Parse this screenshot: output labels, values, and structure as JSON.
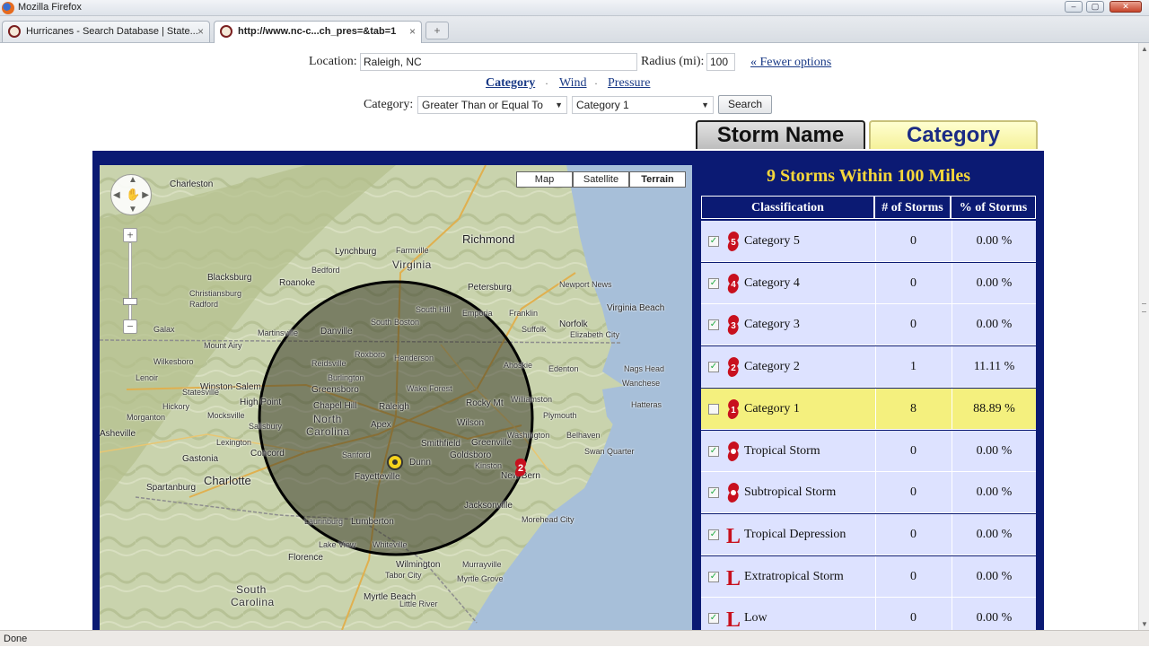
{
  "window": {
    "title": "Mozilla Firefox"
  },
  "tabs": [
    {
      "label": "Hurricanes - Search Database | State..."
    },
    {
      "label": "http://www.nc-c...ch_pres=&tab=1"
    }
  ],
  "form": {
    "location_label": "Location:",
    "location_value": "Raleigh, NC",
    "radius_label": "Radius (mi):",
    "radius_value": "100",
    "fewer_options": "« Fewer options",
    "search_modes": [
      "Category",
      "Wind",
      "Pressure"
    ],
    "category_label": "Category:",
    "comparator": "Greater Than or Equal To",
    "category_value": "Category 1",
    "search_button": "Search"
  },
  "view_tabs": {
    "storm_name": "Storm Name",
    "category": "Category"
  },
  "map": {
    "types": [
      "Map",
      "Satellite",
      "Terrain"
    ],
    "selected_type": "Terrain",
    "center_label": "Raleigh",
    "storm_marker": "2",
    "labels": {
      "charleston_wv": "Charleston",
      "richmond": "Richmond",
      "lynchburg": "Lynchburg",
      "virginia": "Virginia",
      "roanoke": "Roanoke",
      "blacksburg": "Blacksburg",
      "petersburg": "Petersburg",
      "virginia_beach": "Virginia Beach",
      "norfolk": "Norfolk",
      "danville": "Danville",
      "winston_salem": "Winston-Salem",
      "greensboro": "Greensboro",
      "high_point": "High Point",
      "chapel_hill": "Chapel Hill",
      "north_carolina_1": "North",
      "north_carolina_2": "Carolina",
      "apex": "Apex",
      "rocky_mount": "Rocky Mt",
      "wilson": "Wilson",
      "greenville": "Greenville",
      "asheville": "Asheville",
      "concord": "Concord",
      "charlotte": "Charlotte",
      "gastonia": "Gastonia",
      "spartanburg": "Spartanburg",
      "fayetteville": "Fayetteville",
      "goldsboro": "Goldsboro",
      "smithfield": "Smithfield",
      "dunn": "Dunn",
      "new_bern": "New Bern",
      "jacksonville": "Jacksonville",
      "lumberton": "Lumberton",
      "wilmington": "Wilmington",
      "south_carolina_1": "South",
      "south_carolina_2": "Carolina",
      "myrtle_beach": "Myrtle Beach",
      "florence": "Florence",
      "hatteras": "Hatteras",
      "plymouth": "Plymouth",
      "martinsville": "Martinsville",
      "south_boston": "South Boston",
      "henderson": "Henderson",
      "roxboro": "Roxboro",
      "reidsville": "Reidsville",
      "burlington": "Burlington",
      "hickory": "Hickory",
      "salisbury": "Salisbury",
      "lexington": "Lexington",
      "sanford": "Sanford",
      "lake_view": "Lake View",
      "elizabeth_city": "Elizabeth City",
      "suffolk": "Suffolk",
      "newport_news": "Newport News",
      "murrayville": "Murrayville",
      "myrtle_grove": "Myrtle Grove",
      "laurinburg": "Laurinburg",
      "whiteville": "Whiteville",
      "tabor_city": "Tabor City",
      "little_river": "Little River",
      "morehead_city": "Morehead City",
      "nags_head": "Nags Head",
      "wanchese": "Wanchese",
      "edenton": "Edenton",
      "kinston": "Kinston",
      "wake_forest": "Wake Forest",
      "mocksville": "Mocksville",
      "statesville": "Statesville",
      "morganton": "Morganton",
      "lenoir": "Lenoir",
      "wilkesboro": "Wilkesboro",
      "mount_airy": "Mount Airy",
      "galax": "Galax",
      "radford": "Radford",
      "christiansburg": "Christiansburg",
      "bedford": "Bedford",
      "farmville": "Farmville",
      "south_hill": "South Hill",
      "emporia": "Emporia",
      "franklin": "Franklin",
      "ahoskie": "Ahoskie",
      "williamston": "Williamston",
      "washington": "Washington",
      "belhaven": "Belhaven",
      "swan_quarter": "Swan Quarter"
    }
  },
  "table": {
    "title": "9 Storms Within 100 Miles",
    "headers": [
      "Classification",
      "# of Storms",
      "% of Storms"
    ],
    "rows": [
      {
        "name": "Category 5",
        "count": "0",
        "pct": "0.00 %",
        "checked": true,
        "icon": "hurricane-icon",
        "icon_text": "5"
      },
      {
        "name": "Category 4",
        "count": "0",
        "pct": "0.00 %",
        "checked": true,
        "icon": "hurricane-icon",
        "icon_text": "4"
      },
      {
        "name": "Category 3",
        "count": "0",
        "pct": "0.00 %",
        "checked": true,
        "icon": "hurricane-icon",
        "icon_text": "3"
      },
      {
        "name": "Category 2",
        "count": "1",
        "pct": "11.11 %",
        "checked": true,
        "icon": "hurricane-icon",
        "icon_text": "2"
      },
      {
        "name": "Category 1",
        "count": "8",
        "pct": "88.89 %",
        "checked": false,
        "icon": "hurricane-icon",
        "icon_text": "1"
      },
      {
        "name": "Tropical Storm",
        "count": "0",
        "pct": "0.00 %",
        "checked": true,
        "icon": "tropical-storm-icon",
        "icon_text": ""
      },
      {
        "name": "Subtropical Storm",
        "count": "0",
        "pct": "0.00 %",
        "checked": true,
        "icon": "tropical-storm-icon",
        "icon_text": ""
      },
      {
        "name": "Tropical Depression",
        "count": "0",
        "pct": "0.00 %",
        "checked": true,
        "icon": "low-icon",
        "icon_text": "L"
      },
      {
        "name": "Extratropical Storm",
        "count": "0",
        "pct": "0.00 %",
        "checked": true,
        "icon": "low-icon",
        "icon_text": "L"
      },
      {
        "name": "Low",
        "count": "0",
        "pct": "0.00 %",
        "checked": true,
        "icon": "low-icon",
        "icon_text": "L"
      }
    ]
  },
  "status": "Done",
  "colors": {
    "navy": "#0b1a73",
    "gold": "#f4d63b",
    "row": "#dde2ff",
    "highlight": "#f4f07e",
    "hurricane_red": "#c8101e"
  }
}
